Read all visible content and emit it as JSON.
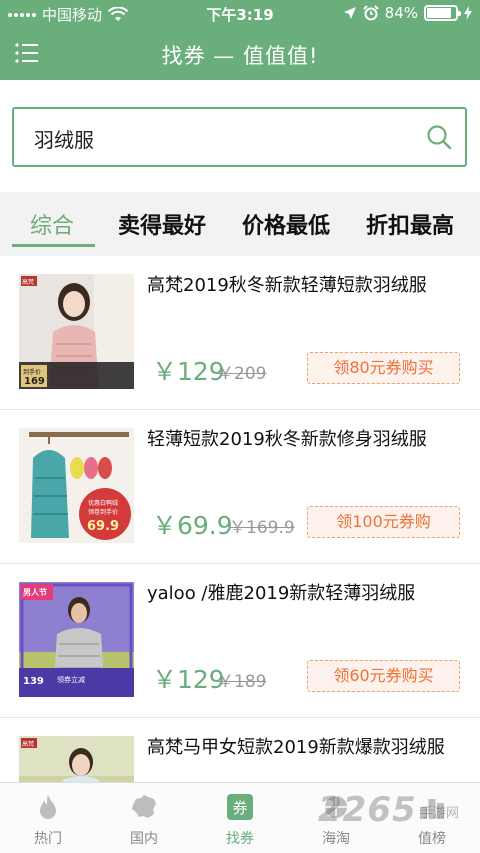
{
  "status_bar": {
    "carrier": "中国移动",
    "time": "下午3:19",
    "battery": "84%",
    "battery_level": 0.84
  },
  "header": {
    "title": "找券 — 值值值!"
  },
  "search": {
    "value": "羽绒服"
  },
  "sort_tabs": [
    {
      "label": "综合",
      "active": true
    },
    {
      "label": "卖得最好",
      "active": false
    },
    {
      "label": "价格最低",
      "active": false
    },
    {
      "label": "折扣最高",
      "active": false
    }
  ],
  "products": [
    {
      "title": "高梵2019秋冬新款轻薄短款羽绒服",
      "price": "￥129",
      "original_price": "￥209",
      "coupon": "领80元券购买",
      "thumb_text": {
        "brand": "高梵",
        "badge": "到手价",
        "price": "169"
      }
    },
    {
      "title": "轻薄短款2019秋冬新款修身羽绒服",
      "price": "￥69.9",
      "original_price": "￥169.9",
      "coupon": "领100元券购",
      "thumb_text": {
        "line1": "优惠白鸭绒",
        "line2": "领卷到手价",
        "price": "69.9"
      }
    },
    {
      "title": "yaloo /雅鹿2019新款轻薄羽绒服",
      "price": "￥129",
      "original_price": "￥189",
      "coupon": "领60元券购买",
      "thumb_text": {
        "badge": "男人节",
        "price": "139",
        "coupon": "领券立减"
      }
    },
    {
      "title": "高梵马甲女短款2019新款爆款羽绒服",
      "price": "",
      "original_price": "",
      "coupon": "",
      "thumb_text": {
        "brand": "高梵"
      }
    }
  ],
  "bottom_nav": [
    {
      "label": "热门",
      "icon": "flame-icon",
      "active": false
    },
    {
      "label": "国内",
      "icon": "china-map-icon",
      "active": false
    },
    {
      "label": "找券",
      "icon": "coupon-icon",
      "icon_text": "券",
      "active": true
    },
    {
      "label": "海淘",
      "icon": "globe-icon",
      "active": false
    },
    {
      "label": "值榜",
      "icon": "ranking-icon",
      "active": false
    }
  ],
  "watermark": {
    "main": "2265",
    "sub": "手游网"
  },
  "colors": {
    "brand_green": "#6aae7c",
    "coupon_orange": "#f0703a",
    "coupon_bg": "#fdf3ec"
  }
}
